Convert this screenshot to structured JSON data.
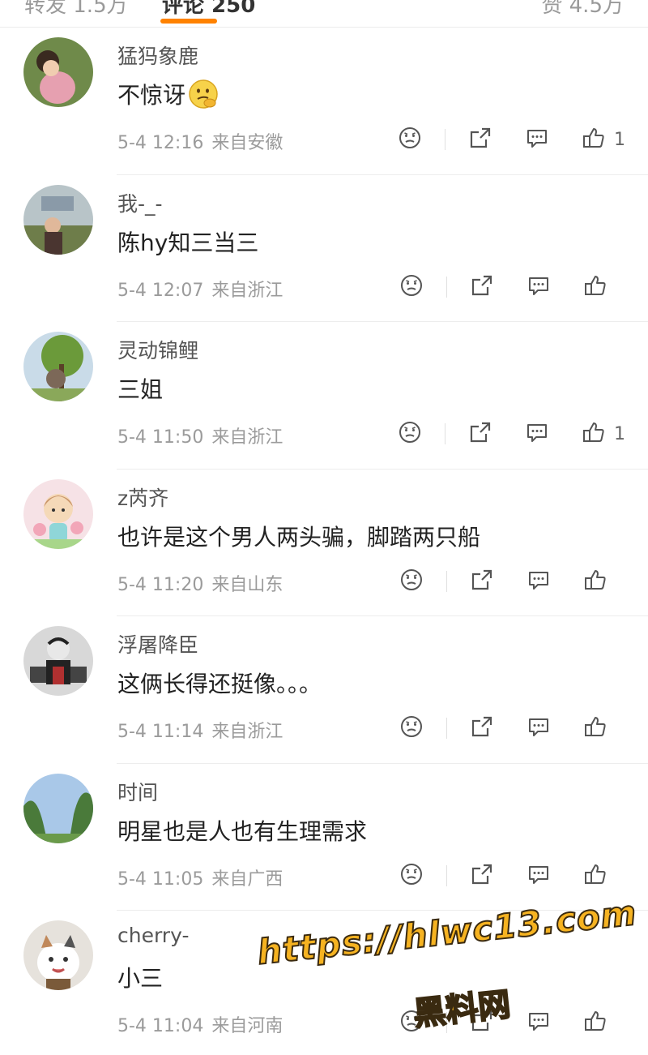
{
  "tabs": [
    {
      "label": "转发 1.5万"
    },
    {
      "label": "评论 250"
    },
    {
      "label": "赞 4.5万"
    }
  ],
  "accent_color": "#ff8200",
  "icons": {
    "dislike": "frown-face-icon",
    "share": "share-icon",
    "reply": "comment-bubble-icon",
    "like": "thumbs-up-icon"
  },
  "comments": [
    {
      "username": "猛犸象鹿",
      "text": "不惊讶",
      "emoji": "thinking-face-emoji",
      "time": "5-4 12:16",
      "location": "来自安徽",
      "likes": "1"
    },
    {
      "username": "我-_-",
      "text": "陈hy知三当三",
      "time": "5-4 12:07",
      "location": "来自浙江",
      "likes": ""
    },
    {
      "username": "灵动锦鲤",
      "text": "三姐",
      "time": "5-4 11:50",
      "location": "来自浙江",
      "likes": "1"
    },
    {
      "username": "z芮齐",
      "text": "也许是这个男人两头骗，脚踏两只船",
      "time": "5-4 11:20",
      "location": "来自山东",
      "likes": ""
    },
    {
      "username": "浮屠降臣",
      "text": "这俩长得还挺像。。。",
      "time": "5-4 11:14",
      "location": "来自浙江",
      "likes": ""
    },
    {
      "username": "时间",
      "text": "明星也是人也有生理需求",
      "time": "5-4 11:05",
      "location": "来自广西",
      "likes": ""
    },
    {
      "username": "cherry-",
      "text": "小三",
      "time": "5-4 11:04",
      "location": "来自河南",
      "likes": ""
    }
  ],
  "watermark": {
    "line1": "https://hlwc13.com",
    "line2": "黑料网"
  }
}
